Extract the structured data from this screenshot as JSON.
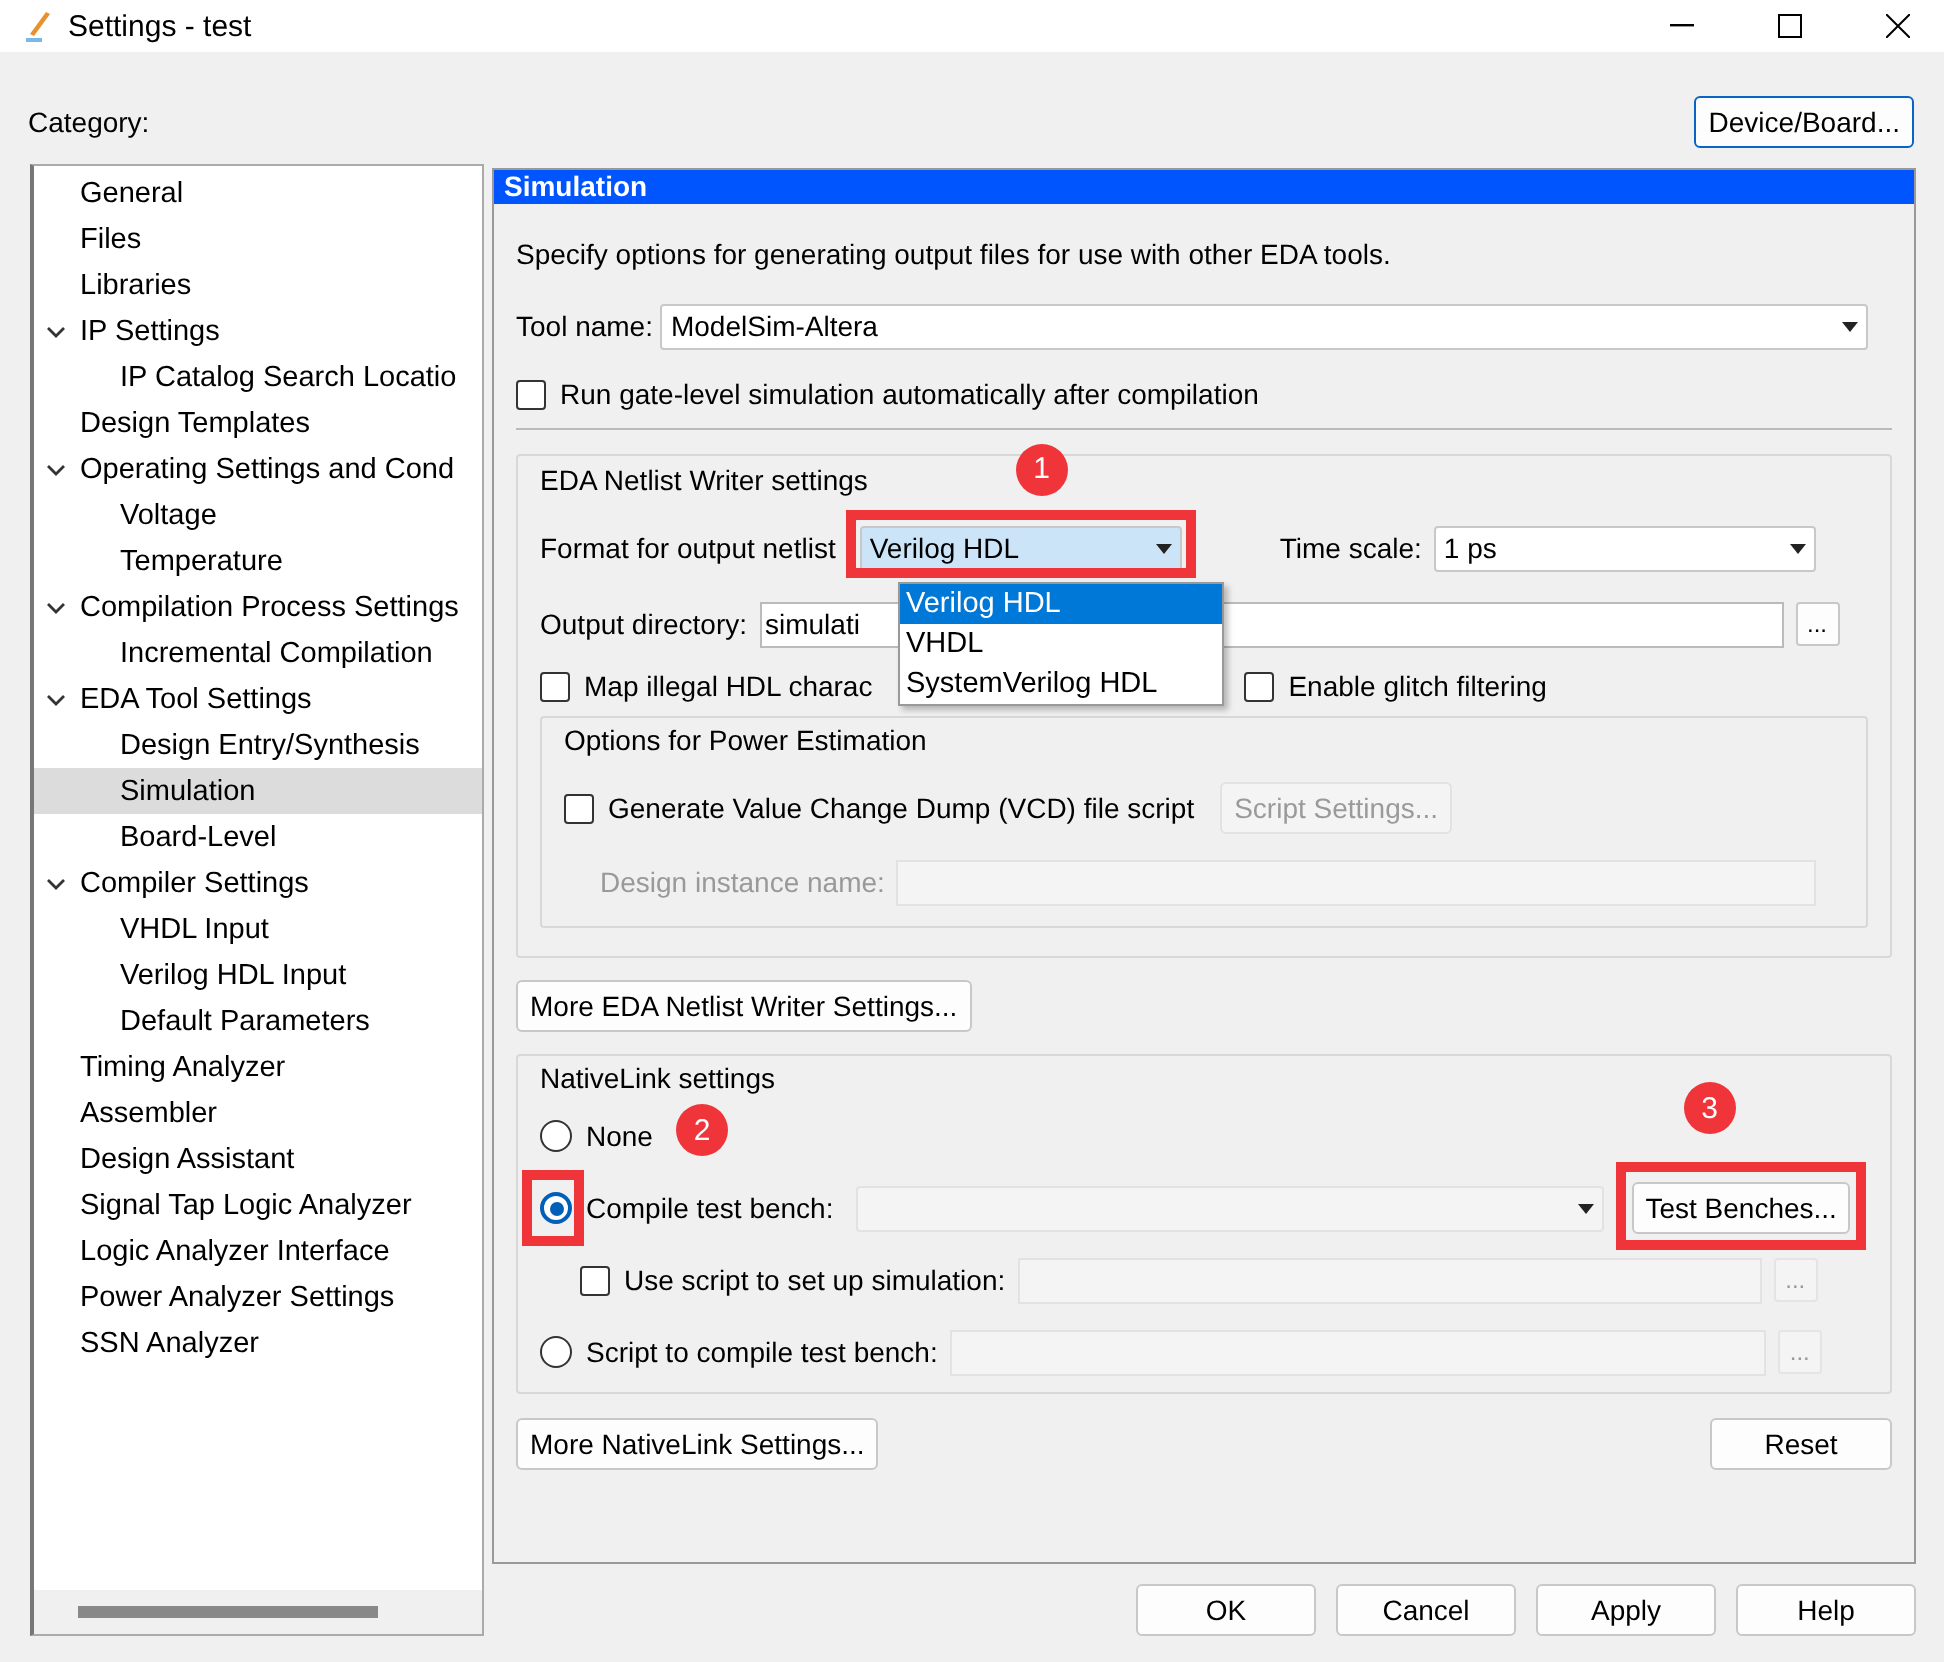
{
  "window": {
    "title": "Settings - test"
  },
  "category_label": "Category:",
  "device_button": "Device/Board...",
  "tree": [
    {
      "label": "General",
      "selected": false
    },
    {
      "label": "Files",
      "selected": false
    },
    {
      "label": "Libraries",
      "selected": false
    },
    {
      "label": "IP Settings",
      "selected": false,
      "expanded": true,
      "children": [
        {
          "label": "IP Catalog Search Locatio",
          "selected": false
        }
      ]
    },
    {
      "label": "Design Templates",
      "selected": false
    },
    {
      "label": "Operating Settings and Cond",
      "selected": false,
      "expanded": true,
      "children": [
        {
          "label": "Voltage",
          "selected": false
        },
        {
          "label": "Temperature",
          "selected": false
        }
      ]
    },
    {
      "label": "Compilation Process Settings",
      "selected": false,
      "expanded": true,
      "children": [
        {
          "label": "Incremental Compilation",
          "selected": false
        }
      ]
    },
    {
      "label": "EDA Tool Settings",
      "selected": false,
      "expanded": true,
      "children": [
        {
          "label": "Design Entry/Synthesis",
          "selected": false
        },
        {
          "label": "Simulation",
          "selected": true
        },
        {
          "label": "Board-Level",
          "selected": false
        }
      ]
    },
    {
      "label": "Compiler Settings",
      "selected": false,
      "expanded": true,
      "children": [
        {
          "label": "VHDL Input",
          "selected": false
        },
        {
          "label": "Verilog HDL Input",
          "selected": false
        },
        {
          "label": "Default Parameters",
          "selected": false
        }
      ]
    },
    {
      "label": "Timing Analyzer",
      "selected": false
    },
    {
      "label": "Assembler",
      "selected": false
    },
    {
      "label": "Design Assistant",
      "selected": false
    },
    {
      "label": "Signal Tap Logic Analyzer",
      "selected": false
    },
    {
      "label": "Logic Analyzer Interface",
      "selected": false
    },
    {
      "label": "Power Analyzer Settings",
      "selected": false
    },
    {
      "label": "SSN Analyzer",
      "selected": false
    }
  ],
  "panel": {
    "title": "Simulation",
    "description": "Specify options for generating output files for use with other EDA tools.",
    "tool_name": {
      "label": "Tool name:",
      "value": "ModelSim-Altera"
    },
    "gate_level": {
      "label": "Run gate-level simulation automatically after compilation",
      "checked": false
    },
    "netlist": {
      "title": "EDA Netlist Writer settings",
      "format": {
        "label": "Format for output netlist",
        "value": "Verilog HDL",
        "open": true,
        "options": [
          {
            "label": "Verilog HDL",
            "selected": true
          },
          {
            "label": "VHDL",
            "selected": false
          },
          {
            "label": "SystemVerilog HDL",
            "selected": false
          }
        ]
      },
      "time_scale": {
        "label": "Time scale:",
        "value": "1 ps"
      },
      "output_directory": {
        "label": "Output directory:",
        "value": "simulati",
        "browse": "..."
      },
      "map_illegal": {
        "label": "Map illegal HDL charac",
        "checked": false
      },
      "glitch": {
        "label": "Enable glitch filtering",
        "checked": false
      },
      "power": {
        "title": "Options for Power Estimation",
        "vcd": {
          "label": "Generate Value Change Dump (VCD) file script",
          "checked": false
        },
        "script_settings": {
          "label": "Script Settings...",
          "disabled": true
        },
        "instance": {
          "label": "Design instance name:",
          "disabled": true
        }
      }
    },
    "more_netlist": "More EDA Netlist Writer Settings...",
    "nativelink": {
      "title": "NativeLink settings",
      "options": [
        {
          "label": "None",
          "selected": false
        },
        {
          "label": "Compile test bench:",
          "selected": true
        },
        {
          "label": "Script to compile test bench:",
          "selected": false
        }
      ],
      "test_benches": "Test Benches...",
      "use_script": {
        "label": "Use script to set up simulation:",
        "checked": false
      },
      "browse": [
        "...",
        "..."
      ]
    },
    "more_nativelink": "More NativeLink Settings...",
    "reset": "Reset"
  },
  "buttons": [
    "OK",
    "Cancel",
    "Apply",
    "Help"
  ],
  "annotations": [
    {
      "label": "1"
    },
    {
      "label": "2"
    },
    {
      "label": "3"
    }
  ]
}
